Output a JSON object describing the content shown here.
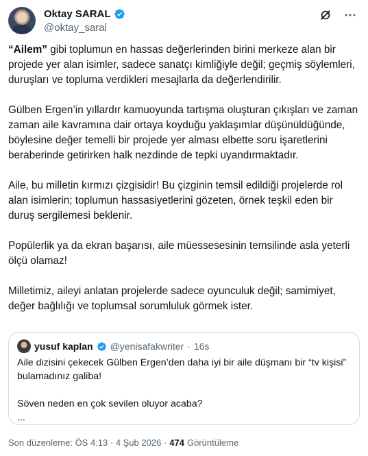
{
  "author": {
    "display_name": "Oktay SARAL",
    "handle": "@oktay_saral"
  },
  "tweet": {
    "paragraphs": [
      {
        "bold": "“Ailem”",
        "text": " gibi toplumun en hassas değerlerinden birini merkeze alan bir projede yer alan isimler, sadece sanatçı kimliğiyle değil; geçmiş söylemleri, duruşları ve topluma verdikleri mesajlarla da değerlendirilir."
      },
      {
        "bold": "",
        "text": "Gülben Ergen’in yıllardır kamuoyunda tartışma oluşturan çıkışları ve zaman zaman aile kavramına dair ortaya koyduğu yaklaşımlar düşünüldüğünde, böylesine değer temelli bir projede yer alması elbette soru işaretlerini beraberinde getirirken halk nezdinde de tepki uyandırmaktadır."
      },
      {
        "bold": "",
        "text": "Aile, bu milletin kırmızı çizgisidir! Bu çizginin temsil edildiği projelerde rol alan isimlerin; toplumun hassasiyetlerini gözeten, örnek teşkil eden bir duruş sergilemesi beklenir."
      },
      {
        "bold": "",
        "text": "Popülerlik ya da ekran başarısı, aile müessesesinin temsilinde asla yeterli ölçü olamaz!"
      },
      {
        "bold": "",
        "text": "Milletimiz, aileyi anlatan projelerde sadece oyunculuk değil; samimiyet, değer bağlılığı ve toplumsal sorumluluk görmek ister."
      }
    ]
  },
  "quoted": {
    "display_name": "yusuf kaplan",
    "handle": "@yenisafakwriter",
    "dot": "·",
    "time": "16s",
    "line1": "Aile dizisini çekecek Gülben Ergen’den daha iyi bir aile düşmanı bir “tv kişisi” bulamadınız galiba!",
    "line2": "Söven neden en çok sevilen oluyor acaba?",
    "ellipsis": "..."
  },
  "meta": {
    "edited": "Son düzenleme: ÖS 4:13 · 4 Şub 2026 ·",
    "views_count": "474",
    "views_label": "Görüntüleme"
  },
  "icons": {
    "verified_color": "#1d9bf0",
    "grok": "grok-icon",
    "more": "more-icon"
  }
}
